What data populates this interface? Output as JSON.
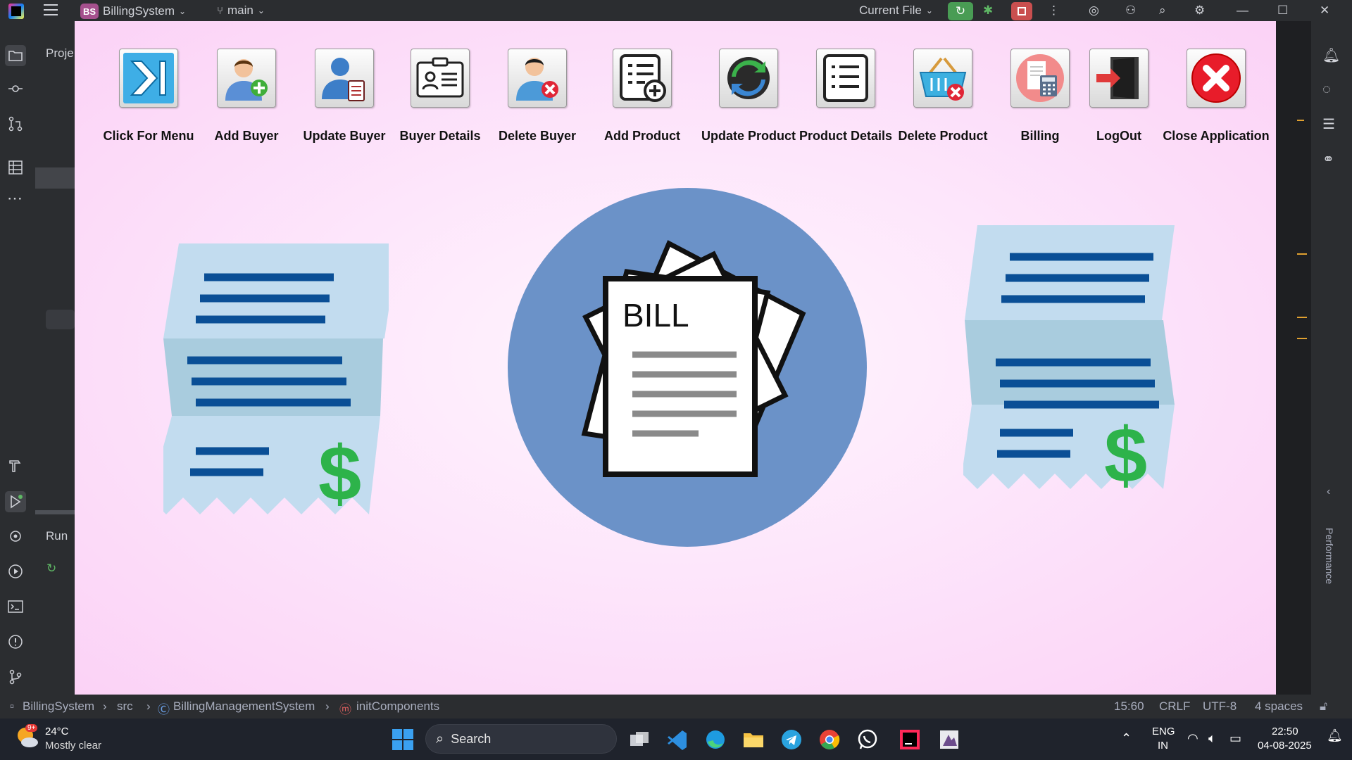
{
  "ide": {
    "project_badge": "BS",
    "project_name": "BillingSystem",
    "branch": "main",
    "run_config": "Current File",
    "sidepanel_project_label": "Proje",
    "run_label": "Run",
    "performance_label": "Performance"
  },
  "app": {
    "menu": [
      {
        "label": "Click For Menu",
        "icon": "menu-arrow-icon"
      },
      {
        "label": "Add Buyer",
        "icon": "add-user-icon"
      },
      {
        "label": "Update Buyer",
        "icon": "update-user-icon"
      },
      {
        "label": "Buyer Details",
        "icon": "id-card-icon"
      },
      {
        "label": "Delete Buyer",
        "icon": "delete-user-icon"
      },
      {
        "label": "Add Product",
        "icon": "add-list-icon"
      },
      {
        "label": "Update Product",
        "icon": "refresh-icon"
      },
      {
        "label": "Product Details",
        "icon": "list-icon"
      },
      {
        "label": "Delete Product",
        "icon": "delete-basket-icon"
      },
      {
        "label": "Billing",
        "icon": "calculator-receipt-icon"
      },
      {
        "label": "LogOut",
        "icon": "logout-door-icon"
      },
      {
        "label": "Close Application",
        "icon": "close-circle-icon"
      }
    ],
    "bill_text": "BILL",
    "dollar": "$",
    "colors": {
      "circle": "#6b92c8",
      "receipt": "#c2dcef",
      "receipt_band": "#a9ccde",
      "receipt_line": "#0a4f96",
      "dollar": "#2db34a"
    }
  },
  "statusbar": {
    "crumbs": [
      "BillingSystem",
      "src",
      "BillingManagementSystem",
      "initComponents"
    ],
    "position": "15:60",
    "line_sep": "CRLF",
    "encoding": "UTF-8",
    "indent": "4 spaces"
  },
  "taskbar": {
    "weather_temp": "24°C",
    "weather_desc": "Mostly clear",
    "weather_badge": "9+",
    "search_placeholder": "Search",
    "lang1": "ENG",
    "lang2": "IN",
    "time": "22:50",
    "date": "04-08-2025"
  }
}
